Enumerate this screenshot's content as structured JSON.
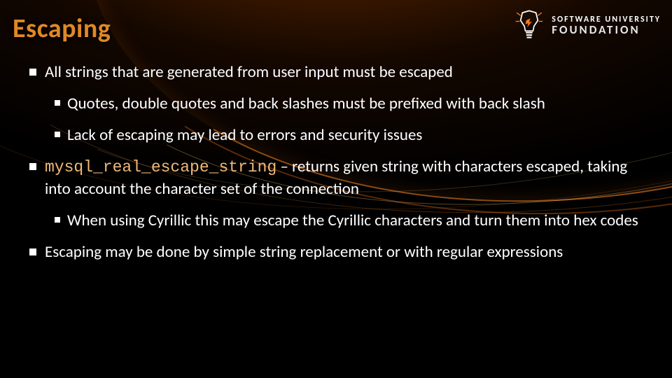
{
  "title": "Escaping",
  "logo": {
    "line1": "SOFTWARE UNIVERSITY",
    "line2": "FOUNDATION"
  },
  "bullets": {
    "l1a": "All strings that are generated from user input must be escaped",
    "l1a_sub1": "Quotes, double quotes and back slashes must be prefixed with back slash",
    "l1a_sub2": "Lack of escaping may lead to errors and security issues",
    "l1b_code": "mysql_real_escape_string",
    "l1b_rest": " – returns given string with characters escaped, taking into account the character set of the connection",
    "l1b_sub1": "When using Cyrillic this may escape the Cyrillic characters and turn them into hex codes",
    "l1c": "Escaping may be done by simple string replacement or with regular expressions"
  }
}
